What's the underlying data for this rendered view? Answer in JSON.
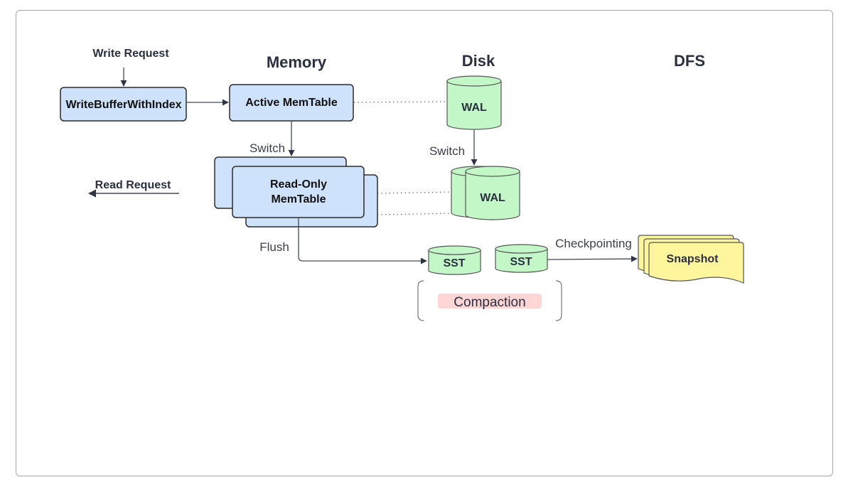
{
  "colors": {
    "memory_fill": "#cfe2fc",
    "disk_fill": "#c3f7c8",
    "dfs_fill": "#fff59d",
    "compaction_fill": "#ffd6d6",
    "stroke": "#2b2b2b",
    "edge": "#434a57"
  },
  "headers": {
    "memory": "Memory",
    "disk": "Disk",
    "dfs": "DFS"
  },
  "requests": {
    "write": "Write Request",
    "read": "Read Request"
  },
  "nodes": {
    "write_buffer": "WriteBufferWithIndex",
    "active_memtable": "Active MemTable",
    "readonly_memtable_line1": "Read-Only",
    "readonly_memtable_line2": "MemTable",
    "wal_active": "WAL",
    "wal_switched": "WAL",
    "sst_1": "SST",
    "sst_2": "SST",
    "snapshot": "Snapshot",
    "compaction": "Compaction"
  },
  "edges": {
    "memtable_switch": "Switch",
    "wal_switch": "Switch",
    "flush": "Flush",
    "checkpointing": "Checkpointing"
  }
}
